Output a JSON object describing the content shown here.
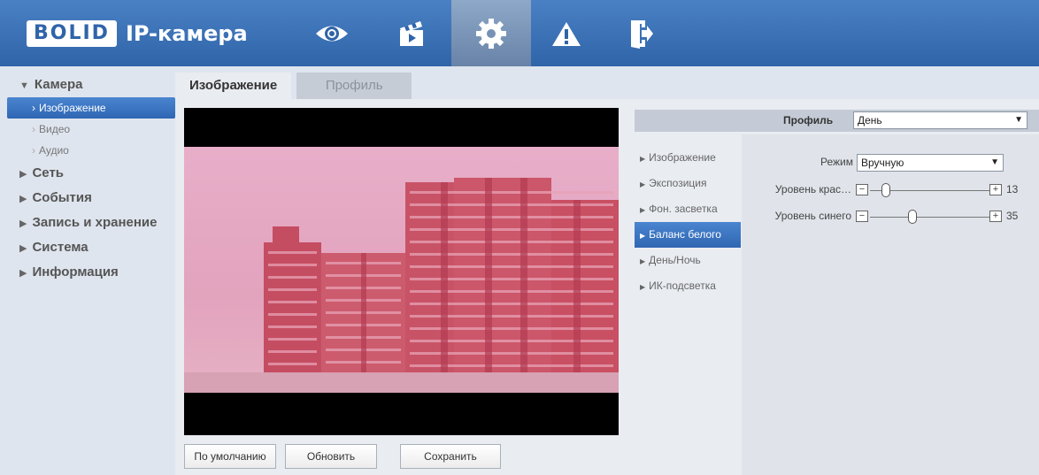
{
  "header": {
    "logo_box": "BOLID",
    "logo_text": "IP-камера",
    "nav": [
      {
        "icon": "eye-icon"
      },
      {
        "icon": "clapperboard-icon"
      },
      {
        "icon": "gear-icon",
        "active": true
      },
      {
        "icon": "warning-icon"
      },
      {
        "icon": "exit-icon"
      }
    ]
  },
  "sidebar": {
    "groups": [
      {
        "label": "Камера",
        "expanded": true
      },
      {
        "label": "Сеть"
      },
      {
        "label": "События"
      },
      {
        "label": "Запись и хранение"
      },
      {
        "label": "Система"
      },
      {
        "label": "Информация"
      }
    ],
    "camera_items": [
      "Изображение",
      "Видео",
      "Аудио"
    ],
    "active_item": "Изображение"
  },
  "tabs": {
    "image": "Изображение",
    "profile": "Профиль"
  },
  "buttons": {
    "default": "По умолчанию",
    "refresh": "Обновить",
    "save": "Сохранить"
  },
  "profile": {
    "label": "Профиль",
    "value": "День"
  },
  "submenu": [
    "Изображение",
    "Экспозиция",
    "Фон. засветка",
    "Баланс белого",
    "День/Ночь",
    "ИК-подсветка"
  ],
  "submenu_active": "Баланс белого",
  "settings": {
    "mode_label": "Режим",
    "mode_value": "Вручную",
    "red_label": "Уровень крас…",
    "red_value": "13",
    "blue_label": "Уровень синего",
    "blue_value": "35"
  },
  "colors": {
    "header": "#3a6fb5",
    "accent": "#2f66b3"
  }
}
